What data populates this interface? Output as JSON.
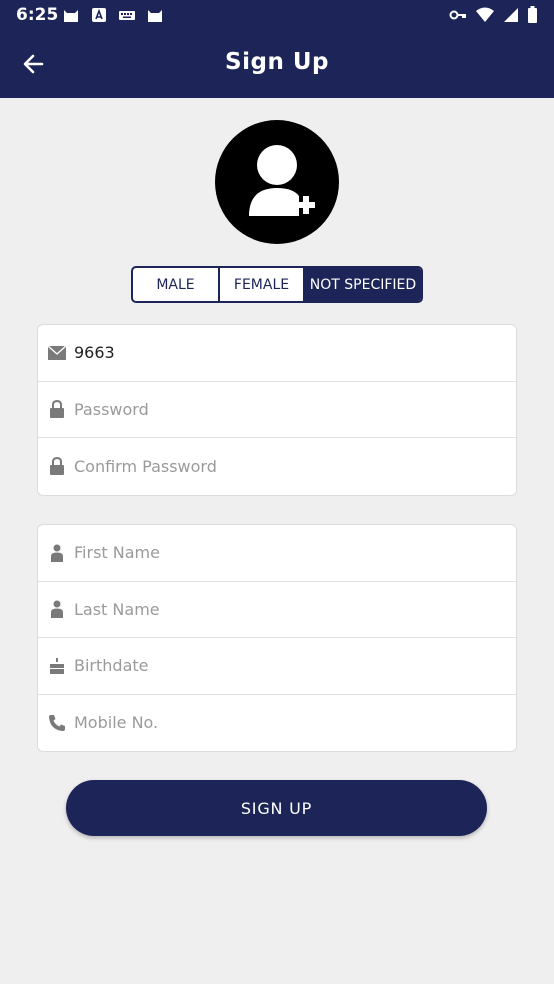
{
  "status_bar": {
    "time": "6:25",
    "notification_icons": [
      "cat-icon",
      "font-a-icon",
      "keyboard-icon",
      "cat-icon"
    ],
    "system_icons": [
      "key-icon",
      "wifi-icon",
      "signal-icon",
      "battery-icon"
    ]
  },
  "header": {
    "title": "Sign Up",
    "back_icon": "arrow-left-icon"
  },
  "avatar": {
    "icon": "add-user-icon"
  },
  "gender": {
    "options": [
      "MALE",
      "FEMALE",
      "NOT SPECIFIED"
    ],
    "selected": "NOT SPECIFIED"
  },
  "account": {
    "email": {
      "value": "9663",
      "placeholder": "",
      "icon": "envelope-icon"
    },
    "password": {
      "value": "",
      "placeholder": "Password",
      "icon": "lock-icon"
    },
    "confirm_password": {
      "value": "",
      "placeholder": "Confirm Password",
      "icon": "lock-icon"
    }
  },
  "profile": {
    "first_name": {
      "value": "",
      "placeholder": "First Name",
      "icon": "person-icon"
    },
    "last_name": {
      "value": "",
      "placeholder": "Last Name",
      "icon": "person-icon"
    },
    "birthdate": {
      "value": "",
      "placeholder": "Birthdate",
      "icon": "cake-icon"
    },
    "mobile": {
      "value": "",
      "placeholder": "Mobile No.",
      "icon": "phone-icon"
    }
  },
  "signup_button": {
    "label": "SIGN UP"
  },
  "colors": {
    "primary": "#1d2558",
    "background": "#efefef",
    "placeholder": "#9a9a9a"
  }
}
